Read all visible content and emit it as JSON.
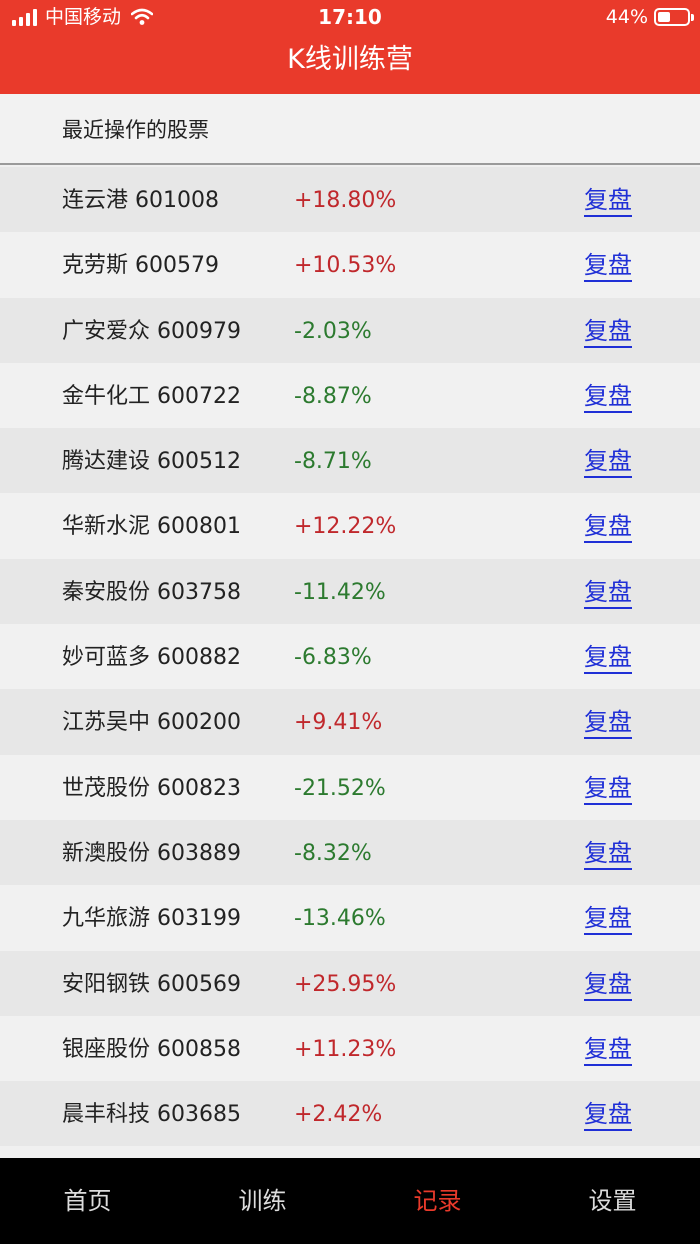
{
  "status_bar": {
    "carrier": "中国移动",
    "time": "17:10",
    "battery_percent": "44%",
    "battery_level": 0.44
  },
  "header": {
    "title": "K线训练营"
  },
  "section": {
    "title": "最近操作的股票"
  },
  "stocks": [
    {
      "name": "连云港 601008",
      "change": "+18.80%",
      "direction": "up",
      "action": "复盘"
    },
    {
      "name": "克劳斯 600579",
      "change": "+10.53%",
      "direction": "up",
      "action": "复盘"
    },
    {
      "name": "广安爱众 600979",
      "change": "-2.03%",
      "direction": "down",
      "action": "复盘"
    },
    {
      "name": "金牛化工 600722",
      "change": "-8.87%",
      "direction": "down",
      "action": "复盘"
    },
    {
      "name": "腾达建设 600512",
      "change": "-8.71%",
      "direction": "down",
      "action": "复盘"
    },
    {
      "name": "华新水泥 600801",
      "change": "+12.22%",
      "direction": "up",
      "action": "复盘"
    },
    {
      "name": "秦安股份 603758",
      "change": "-11.42%",
      "direction": "down",
      "action": "复盘"
    },
    {
      "name": "妙可蓝多 600882",
      "change": "-6.83%",
      "direction": "down",
      "action": "复盘"
    },
    {
      "name": "江苏吴中 600200",
      "change": "+9.41%",
      "direction": "up",
      "action": "复盘"
    },
    {
      "name": "世茂股份 600823",
      "change": "-21.52%",
      "direction": "down",
      "action": "复盘"
    },
    {
      "name": "新澳股份 603889",
      "change": "-8.32%",
      "direction": "down",
      "action": "复盘"
    },
    {
      "name": "九华旅游 603199",
      "change": "-13.46%",
      "direction": "down",
      "action": "复盘"
    },
    {
      "name": "安阳钢铁 600569",
      "change": "+25.95%",
      "direction": "up",
      "action": "复盘"
    },
    {
      "name": "银座股份 600858",
      "change": "+11.23%",
      "direction": "up",
      "action": "复盘"
    },
    {
      "name": "晨丰科技 603685",
      "change": "+2.42%",
      "direction": "up",
      "action": "复盘"
    }
  ],
  "tabs": [
    {
      "label": "首页",
      "active": false
    },
    {
      "label": "训练",
      "active": false
    },
    {
      "label": "记录",
      "active": true
    },
    {
      "label": "设置",
      "active": false
    }
  ],
  "colors": {
    "brand_red": "#e93a2b",
    "up_red": "#c0282c",
    "down_green": "#2c7a2f",
    "link_blue": "#1f2fd6"
  },
  "icons": [
    "signal-icon",
    "wifi-icon",
    "battery-icon"
  ]
}
